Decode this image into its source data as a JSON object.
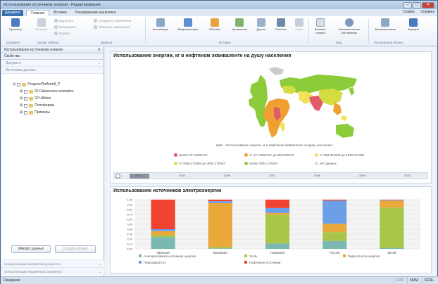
{
  "window": {
    "title": "Использование источников энергии - Редактирование"
  },
  "tabs": {
    "document_btn": "Документ",
    "items": [
      "Главная",
      "Вставка",
      "Расширенная аналитика"
    ],
    "right": [
      "Сервис",
      "Справка"
    ]
  },
  "ribbon": {
    "preview": "Просмотр",
    "paste": "Вставить",
    "cut": "Вырезать",
    "copy": "Копировать",
    "format": "Формат",
    "save_state": "Сохранить изменения",
    "cancel_changes": "Отменить изменения",
    "groups": [
      "Документ",
      "Буфер обмена",
      "Данные",
      "Вставка",
      "Вид",
      "Расширение бизнес"
    ],
    "insert_items": [
      "Контейнеры",
      "Визуализаторы",
      "Объекты",
      "Управление",
      "Другое",
      "Плагины",
      "Связи"
    ],
    "view_items": [
      "Вспомог. панели",
      "Автоматическое обновление"
    ],
    "ext_items": [
      "Автоматическое",
      "Функции"
    ]
  },
  "left": {
    "title": "Использование источников энергии",
    "props": "Свойства",
    "sections": [
      "Документ",
      "Источники данных"
    ],
    "tree": [
      "PrognozPlatform8_P",
      "01 Datasource examples",
      "02 Utilities",
      "Платформы",
      "Примеры"
    ],
    "import_btn": "Импорт данных",
    "create_btn": "Создать объект",
    "footers": [
      "Синхронизация измерений документа",
      "Синхронизация параметров документа"
    ]
  },
  "map": {
    "title": "Использование энергии, кг в нефтяном эквиваленте на душу населения",
    "color_caption": "Цвет : Использование энергии, кг в нефтяном эквиваленте на душу населения",
    "legend": [
      {
        "label": "менее 477,9000147",
        "color": "#e05a6a"
      },
      {
        "label": "от 477,9000147 до 858,092233",
        "color": "#f0a030"
      },
      {
        "label": "от 858,392233 до 1946,472356",
        "color": "#f4e15a"
      },
      {
        "label": "от 1946,472356 до 3834,175334",
        "color": "#d4dc42"
      },
      {
        "label": "более 3834,175334",
        "color": "#8ccc3a"
      },
      {
        "label": "нет данных",
        "color": "#dddddd"
      }
    ],
    "timeline": {
      "years": [
        "2004",
        "2005",
        "2006",
        "2007",
        "2008",
        "2009",
        "2010"
      ],
      "selected": "2004"
    }
  },
  "chart_data": {
    "type": "bar",
    "title": "Использование источников электроэнергии",
    "stacked_percent": true,
    "categories": [
      "Франция",
      "Бразилия",
      "Германия",
      "Россия",
      "Китай"
    ],
    "ylim": [
      0,
      1
    ],
    "y_ticks": [
      "0,00",
      "0,10",
      "0,20",
      "0,30",
      "0,40",
      "0,50",
      "0,60",
      "0,70",
      "0,80",
      "0,90",
      "1,00"
    ],
    "series": [
      {
        "name": "Альтернативная и атомная энергия",
        "color": "#7ab8b0",
        "values": [
          0.24,
          0.01,
          0.11,
          0.16,
          0.02
        ]
      },
      {
        "name": "Уголь",
        "color": "#a8c648",
        "values": [
          0.04,
          0.03,
          0.58,
          0.18,
          0.82
        ]
      },
      {
        "name": "Гидроэлектроэнергия",
        "color": "#eaa83a",
        "values": [
          0.08,
          0.89,
          0.04,
          0.17,
          0.14
        ]
      },
      {
        "name": "Природный газ",
        "color": "#6d9fe8",
        "values": [
          0.04,
          0.04,
          0.1,
          0.47,
          0.01
        ]
      },
      {
        "name": "Нефтяные источники",
        "color": "#f04430",
        "values": [
          0.6,
          0.03,
          0.17,
          0.02,
          0.01
        ]
      }
    ]
  },
  "status": {
    "left": "Ожидание",
    "indicators": [
      "CAP",
      "NUM",
      "SCRL"
    ]
  }
}
